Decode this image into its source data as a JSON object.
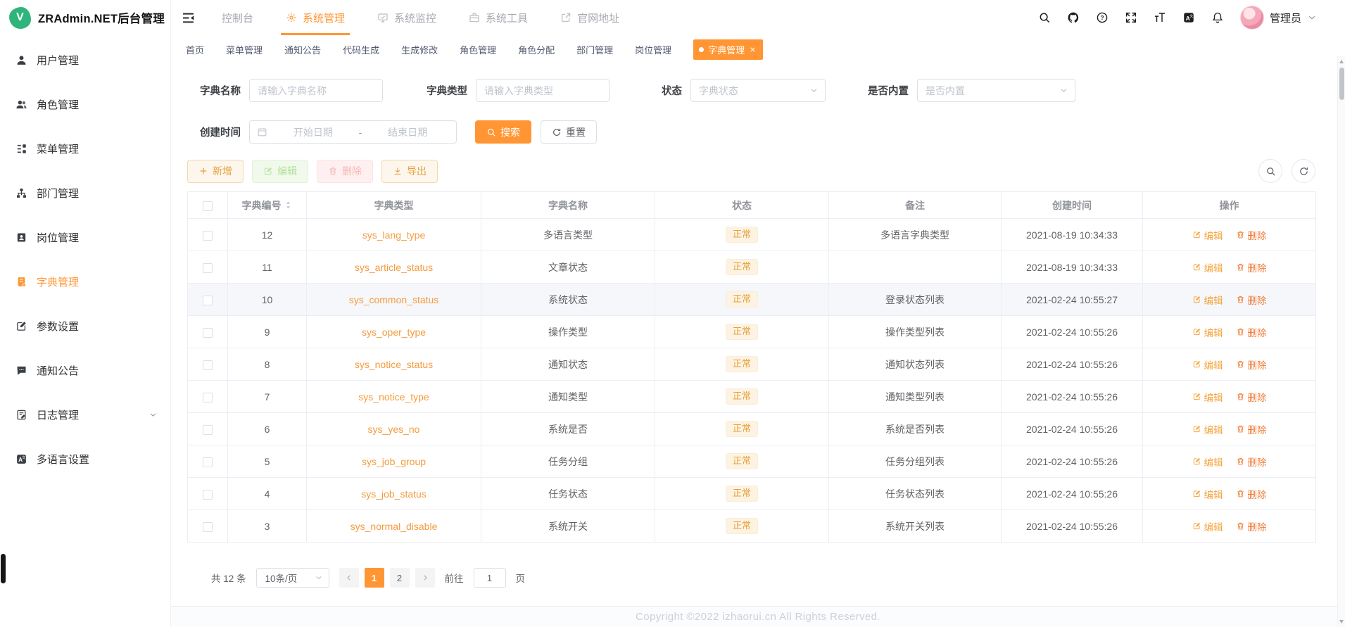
{
  "app": {
    "title": "ZRAdmin.NET后台管理",
    "logo_letter": "V"
  },
  "theme": {
    "accent": "#ff9633",
    "warning": "#e6a23c",
    "danger": "#f56c6c"
  },
  "sidebar": {
    "items": [
      {
        "key": "users",
        "label": "用户管理",
        "icon": "user-icon",
        "active": false
      },
      {
        "key": "roles",
        "label": "角色管理",
        "icon": "roles-icon",
        "active": false
      },
      {
        "key": "menus",
        "label": "菜单管理",
        "icon": "menu-tree-icon",
        "active": false
      },
      {
        "key": "depts",
        "label": "部门管理",
        "icon": "dept-tree-icon",
        "active": false
      },
      {
        "key": "posts",
        "label": "岗位管理",
        "icon": "post-icon",
        "active": false
      },
      {
        "key": "dicts",
        "label": "字典管理",
        "icon": "dict-book-icon",
        "active": true
      },
      {
        "key": "params",
        "label": "参数设置",
        "icon": "param-edit-icon",
        "active": false
      },
      {
        "key": "notices",
        "label": "通知公告",
        "icon": "notice-chat-icon",
        "active": false
      },
      {
        "key": "logs",
        "label": "日志管理",
        "icon": "log-doc-icon",
        "active": false,
        "expandable": true
      },
      {
        "key": "languages",
        "label": "多语言设置",
        "icon": "language-icon",
        "active": false
      }
    ]
  },
  "navbar": {
    "menu": [
      {
        "key": "console",
        "label": "控制台",
        "icon": null,
        "active": false
      },
      {
        "key": "system-admin",
        "label": "系统管理",
        "icon": "gear-icon",
        "active": true
      },
      {
        "key": "system-monitor",
        "label": "系统监控",
        "icon": "monitor-icon",
        "active": false
      },
      {
        "key": "system-tools",
        "label": "系统工具",
        "icon": "toolbox-icon",
        "active": false
      },
      {
        "key": "website",
        "label": "官网地址",
        "icon": "external-link-icon",
        "active": false
      }
    ],
    "right_icons": [
      {
        "name": "search-icon"
      },
      {
        "name": "github-icon"
      },
      {
        "name": "help-icon"
      },
      {
        "name": "fullscreen-icon"
      },
      {
        "name": "font-size-icon"
      },
      {
        "name": "translate-icon"
      },
      {
        "name": "bell-icon",
        "badge": true
      }
    ],
    "user": {
      "name": "管理员"
    }
  },
  "tabs": [
    {
      "key": "home",
      "label": "首页",
      "active": false
    },
    {
      "key": "menus",
      "label": "菜单管理",
      "active": false
    },
    {
      "key": "notices",
      "label": "通知公告",
      "active": false
    },
    {
      "key": "codegen",
      "label": "代码生成",
      "active": false
    },
    {
      "key": "gen-edit",
      "label": "生成修改",
      "active": false
    },
    {
      "key": "roles",
      "label": "角色管理",
      "active": false
    },
    {
      "key": "role-assign",
      "label": "角色分配",
      "active": false
    },
    {
      "key": "depts",
      "label": "部门管理",
      "active": false
    },
    {
      "key": "posts",
      "label": "岗位管理",
      "active": false
    },
    {
      "key": "dicts",
      "label": "字典管理",
      "active": true,
      "closable": true
    }
  ],
  "search_form": {
    "dict_name": {
      "label": "字典名称",
      "placeholder": "请输入字典名称",
      "value": ""
    },
    "dict_type": {
      "label": "字典类型",
      "placeholder": "请输入字典类型",
      "value": ""
    },
    "status": {
      "label": "状态",
      "placeholder": "字典状态"
    },
    "builtin": {
      "label": "是否内置",
      "placeholder": "是否内置"
    },
    "created": {
      "label": "创建时间",
      "start_placeholder": "开始日期",
      "separator": "-",
      "end_placeholder": "结束日期"
    },
    "search_label": "搜索",
    "reset_label": "重置"
  },
  "toolbar": {
    "add_label": "新增",
    "edit_label": "编辑",
    "delete_label": "删除",
    "export_label": "导出"
  },
  "table": {
    "columns": [
      "字典编号",
      "字典类型",
      "字典名称",
      "状态",
      "备注",
      "创建时间",
      "操作"
    ],
    "edit_label": "编辑",
    "delete_label": "删除",
    "rows": [
      {
        "id": "12",
        "type": "sys_lang_type",
        "name": "多语言类型",
        "status": "正常",
        "remark": "多语言字典类型",
        "created": "2021-08-19 10:34:33",
        "highlighted": false
      },
      {
        "id": "11",
        "type": "sys_article_status",
        "name": "文章状态",
        "status": "正常",
        "remark": "",
        "created": "2021-08-19 10:34:33",
        "highlighted": false
      },
      {
        "id": "10",
        "type": "sys_common_status",
        "name": "系统状态",
        "status": "正常",
        "remark": "登录状态列表",
        "created": "2021-02-24 10:55:27",
        "highlighted": true
      },
      {
        "id": "9",
        "type": "sys_oper_type",
        "name": "操作类型",
        "status": "正常",
        "remark": "操作类型列表",
        "created": "2021-02-24 10:55:26",
        "highlighted": false
      },
      {
        "id": "8",
        "type": "sys_notice_status",
        "name": "通知状态",
        "status": "正常",
        "remark": "通知状态列表",
        "created": "2021-02-24 10:55:26",
        "highlighted": false
      },
      {
        "id": "7",
        "type": "sys_notice_type",
        "name": "通知类型",
        "status": "正常",
        "remark": "通知类型列表",
        "created": "2021-02-24 10:55:26",
        "highlighted": false
      },
      {
        "id": "6",
        "type": "sys_yes_no",
        "name": "系统是否",
        "status": "正常",
        "remark": "系统是否列表",
        "created": "2021-02-24 10:55:26",
        "highlighted": false
      },
      {
        "id": "5",
        "type": "sys_job_group",
        "name": "任务分组",
        "status": "正常",
        "remark": "任务分组列表",
        "created": "2021-02-24 10:55:26",
        "highlighted": false
      },
      {
        "id": "4",
        "type": "sys_job_status",
        "name": "任务状态",
        "status": "正常",
        "remark": "任务状态列表",
        "created": "2021-02-24 10:55:26",
        "highlighted": false
      },
      {
        "id": "3",
        "type": "sys_normal_disable",
        "name": "系统开关",
        "status": "正常",
        "remark": "系统开关列表",
        "created": "2021-02-24 10:55:26",
        "highlighted": false
      }
    ]
  },
  "pagination": {
    "total_label": "共 12 条",
    "page_size": "10条/页",
    "pages": [
      "1",
      "2"
    ],
    "active_page": "1",
    "goto_label": "前往",
    "goto_value": "1",
    "page_label": "页"
  },
  "footer": {
    "copyright": "Copyright ©2022 izhaorui.cn All Rights Reserved."
  }
}
